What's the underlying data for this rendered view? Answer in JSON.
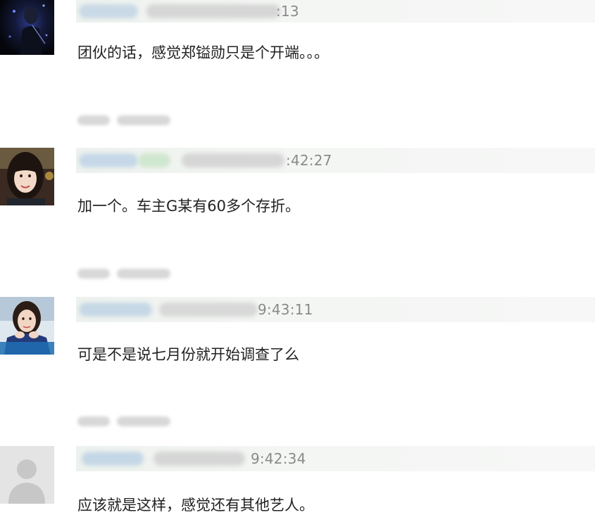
{
  "comments": [
    {
      "timestamp": ":13",
      "text": "团伙的话，感觉郑镒勋只是个开端。。。",
      "avatar_icon": "dark-concert-photo-avatar"
    },
    {
      "timestamp": ":42:27",
      "text": "加一个。车主G某有60多个存折。",
      "avatar_icon": "girl-portrait-avatar"
    },
    {
      "timestamp": "9:43:11",
      "text": "可是不是说七月份就开始调查了么",
      "avatar_icon": "girl-chin-on-hands-avatar"
    },
    {
      "timestamp": "9:42:34",
      "text": "应该就是这样，感觉还有其他艺人。",
      "avatar_icon": "default-user-avatar"
    }
  ],
  "colors": {
    "meta_bar": "#eef2ee",
    "timestamp": "#8a8a8a",
    "comment_text": "#222222",
    "blurred_name": "#c7d8e6"
  }
}
